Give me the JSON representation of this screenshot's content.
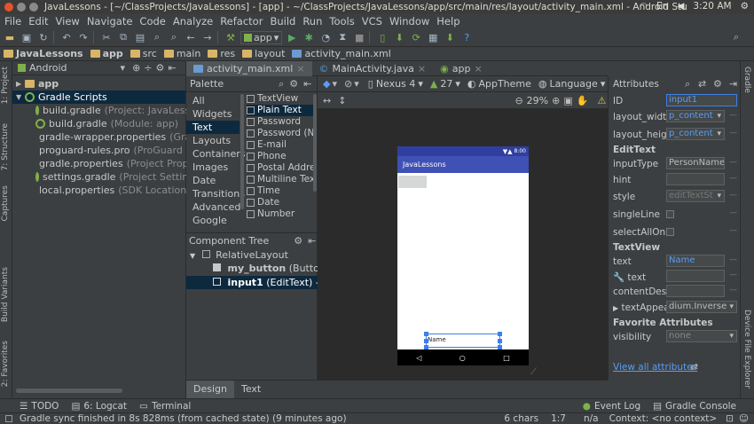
{
  "os": {
    "window_title": "JavaLessons - [~/ClassProjects/JavaLessons] - [app] - ~/ClassProjects/JavaLessons/app/src/main/res/layout/activity_main.xml - Android Stu",
    "keyboard": "En",
    "time": "3:20 AM"
  },
  "menu": [
    "File",
    "Edit",
    "View",
    "Navigate",
    "Code",
    "Analyze",
    "Refactor",
    "Build",
    "Run",
    "Tools",
    "VCS",
    "Window",
    "Help"
  ],
  "toolbar": {
    "run_config": "app"
  },
  "breadcrumb": [
    "JavaLessons",
    "app",
    "src",
    "main",
    "res",
    "layout",
    "activity_main.xml"
  ],
  "project": {
    "view_mode": "Android",
    "tree": [
      {
        "name": "app",
        "desc": "",
        "level": 0
      },
      {
        "name": "Gradle Scripts",
        "desc": "",
        "level": 0
      },
      {
        "name": "build.gradle",
        "desc": "(Project: JavaLesson",
        "level": 1
      },
      {
        "name": "build.gradle",
        "desc": "(Module: app)",
        "level": 1
      },
      {
        "name": "gradle-wrapper.properties",
        "desc": "(Gradle",
        "level": 1
      },
      {
        "name": "proguard-rules.pro",
        "desc": "(ProGuard Rul",
        "level": 1
      },
      {
        "name": "gradle.properties",
        "desc": "(Project Propert",
        "level": 1
      },
      {
        "name": "settings.gradle",
        "desc": "(Project Settings)",
        "level": 1
      },
      {
        "name": "local.properties",
        "desc": "(SDK Location)",
        "level": 1
      }
    ]
  },
  "editor_tabs": [
    "activity_main.xml",
    "MainActivity.java",
    "app"
  ],
  "palette": {
    "title": "Palette",
    "categories": [
      "All",
      "Widgets",
      "Text",
      "Layouts",
      "Containers",
      "Images",
      "Date",
      "Transitions",
      "Advanced",
      "Google"
    ],
    "selected_category": "Text",
    "items": [
      "TextView",
      "Plain Text",
      "Password",
      "Password (N",
      "E-mail",
      "Phone",
      "Postal Addre",
      "Multiline Tex",
      "Time",
      "Date",
      "Number"
    ],
    "selected_item": "Plain Text"
  },
  "component_tree": {
    "title": "Component Tree",
    "root": "RelativeLayout",
    "children": [
      {
        "id": "my_button",
        "type": "(Button)"
      },
      {
        "id": "input1",
        "type": "(EditText) - \"Nar"
      }
    ]
  },
  "design_toolbar": {
    "device": "Nexus 4",
    "api": "27",
    "theme": "AppTheme",
    "language": "Language",
    "zoom": "29%"
  },
  "phone": {
    "time": "8:00",
    "app_title": "JavaLessons",
    "edit_text": "Name"
  },
  "design_tabs": [
    "Design",
    "Text"
  ],
  "attributes": {
    "title": "Attributes",
    "id_label": "ID",
    "id_value": "input1",
    "layout_width_label": "layout_widtl",
    "layout_width_value": "p_content",
    "layout_height_label": "layout_heigl",
    "layout_height_value": "p_content",
    "edittext_section": "EditText",
    "input_type_label": "inputType",
    "input_type_value": "PersonName",
    "hint_label": "hint",
    "style_label": "style",
    "style_value": "editTextSt",
    "single_line_label": "singleLine",
    "select_all_label": "selectAllOnF",
    "textview_section": "TextView",
    "text_label": "text",
    "text_value": "Name",
    "tools_text_label": "text",
    "content_desc_label": "contentDesc",
    "text_appearance_label": "textAppea",
    "text_appearance_value": "dium.Inverse",
    "favorite_section": "Favorite Attributes",
    "visibility_label": "visibility",
    "visibility_value": "none",
    "view_all": "View all attributes"
  },
  "left_strip": [
    "1: Project",
    "7: Structure",
    "Captures",
    "Build Variants",
    "2: Favorites"
  ],
  "right_strip": [
    "Gradle",
    "Device File Explorer"
  ],
  "bottom_tools": [
    "TODO",
    "6: Logcat",
    "Terminal",
    "Event Log",
    "Gradle Console"
  ],
  "status": {
    "message": "Gradle sync finished in 8s 828ms (from cached state) (9 minutes ago)",
    "chars": "6 chars",
    "position": "1:7",
    "na": "n/a",
    "context": "Context: <no context>"
  },
  "colors": {
    "selection": "#0d293e",
    "accent_blue": "#589df6",
    "app_bar": "#3f51b5",
    "status_bar": "#303f9f"
  }
}
